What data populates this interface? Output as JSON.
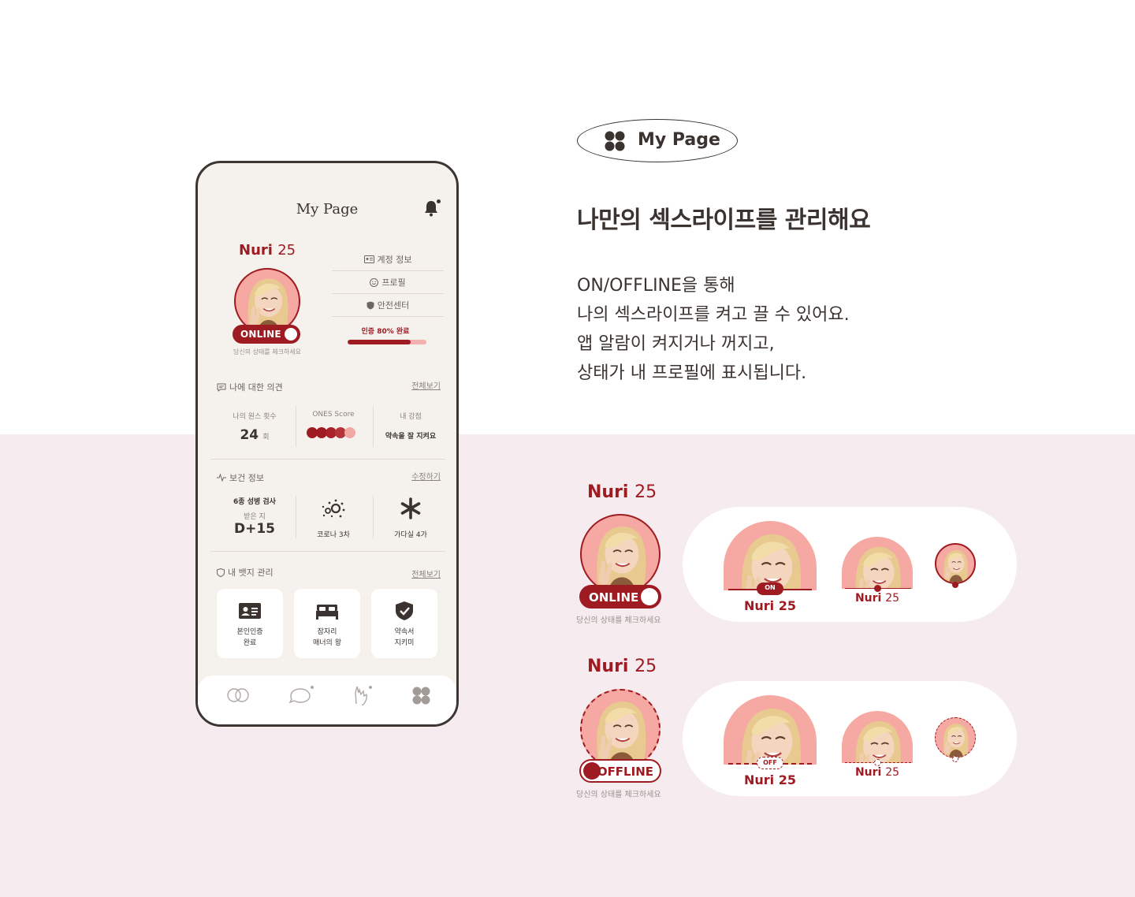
{
  "phone": {
    "title": "My Page",
    "profile": {
      "name": "Nuri",
      "age": "25",
      "status": "ONLINE",
      "hint": "당신의 상태를 체크하세요"
    },
    "menu": [
      {
        "icon": "id-card-icon",
        "label": "계정 정보"
      },
      {
        "icon": "smile-icon",
        "label": "프로필"
      },
      {
        "icon": "shield-icon",
        "label": "안전센터"
      }
    ],
    "verification": {
      "label": "인증 80% 완료",
      "progress": 0.8
    },
    "opinion": {
      "title": "나에 대한 의견",
      "link": "전체보기",
      "stats": [
        {
          "label": "나의 원스 횟수",
          "value": "24",
          "unit": "회"
        },
        {
          "label": "ONES Score",
          "score": 4.5,
          "max": 5
        },
        {
          "label": "내 강점",
          "value": "약속을 잘 지켜요"
        }
      ]
    },
    "health": {
      "title": "보건 정보",
      "link": "수정하기",
      "items": [
        {
          "line1": "6종 성병 검사",
          "line2": "받은 지",
          "value": "D+15"
        },
        {
          "icon": "virus-icon",
          "label": "코로나 3차"
        },
        {
          "icon": "asterisk-icon",
          "label": "가다실 4가"
        }
      ]
    },
    "badges": {
      "title": "내 뱃지 관리",
      "link": "전체보기",
      "items": [
        {
          "icon": "id-badge-icon",
          "label": "본인인증\n완료"
        },
        {
          "icon": "bed-icon",
          "label": "잠자리\n매너의 왕"
        },
        {
          "icon": "shield-check-icon",
          "label": "약속서\n지키미"
        }
      ]
    },
    "tabs": [
      "match-tab-icon",
      "chat-tab-icon",
      "promise-tab-icon",
      "mypage-tab-icon"
    ]
  },
  "feature": {
    "pill": "My Page",
    "headline": "나만의 섹스라이프를 관리해요",
    "body": "ON/OFFLINE을 통해\n나의 섹스라이프를 켜고 끌 수 있어요.\n앱 알람이 켜지거나 꺼지고,\n상태가 내 프로필에 표시됩니다."
  },
  "showcase": {
    "online": {
      "name": "Nuri",
      "age": "25",
      "toggle": "ONLINE",
      "hint": "당신의 상태를 체크하세요",
      "tag": "ON"
    },
    "offline": {
      "name": "Nuri",
      "age": "25",
      "toggle": "OFFLINE",
      "hint": "당신의 상태를 체크하세요",
      "tag": "OFF"
    }
  },
  "colors": {
    "accent": "#9e1b22",
    "avatar_bg": "#f6a8a3",
    "band": "#f6ecef",
    "phone_bg": "#f5f2ee"
  }
}
